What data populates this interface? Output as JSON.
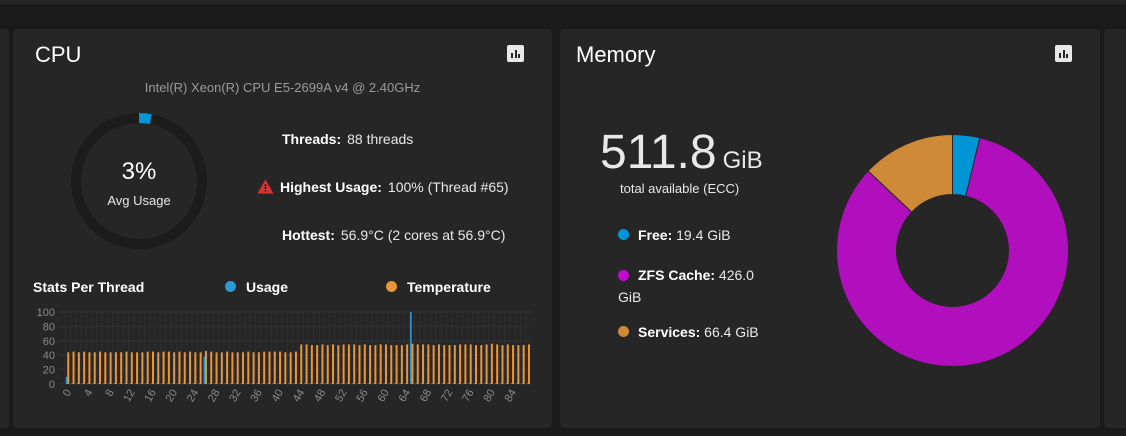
{
  "cpu": {
    "title": "CPU",
    "model": "Intel(R) Xeon(R) CPU E5-2699A v4 @ 2.40GHz",
    "avg_usage_value": "3%",
    "avg_usage_label": "Avg Usage",
    "avg_usage_fraction": 0.03,
    "threads_label": "Threads:",
    "threads_value": "88 threads",
    "highest_label": "Highest Usage:",
    "highest_value": "100%  (Thread #65)",
    "hottest_label": "Hottest:",
    "hottest_value": "56.9°C  (2 cores at 56.9°C)",
    "stats_title": "Stats Per Thread",
    "legend_usage": "Usage",
    "legend_temp": "Temperature",
    "chart_button_icon": "bar-chart-icon",
    "warning_icon": "warning-triangle-icon"
  },
  "memory": {
    "title": "Memory",
    "total_value": "511.8",
    "total_unit": "GiB",
    "total_sub": "total available (ECC)",
    "items": [
      {
        "label": "Free:",
        "value": "19.4 GiB",
        "color": "#0095d5"
      },
      {
        "label": "ZFS Cache:",
        "value": "426.0 GiB",
        "color": "#c10bd0"
      },
      {
        "label": "Services:",
        "value": "66.4 GiB",
        "color": "#ce8a37"
      }
    ],
    "chart_button_icon": "bar-chart-icon"
  },
  "colors": {
    "usage": "#2a9ad6",
    "temperature": "#e8953c",
    "free": "#0095d5",
    "zfs": "#b10fbe",
    "services": "#ce8a37"
  },
  "chart_data": [
    {
      "type": "bar",
      "title": "Stats Per Thread",
      "ylim": [
        0,
        100
      ],
      "yticks": [
        0,
        20,
        40,
        60,
        80,
        100
      ],
      "xticks": [
        0,
        4,
        8,
        12,
        16,
        20,
        24,
        28,
        32,
        36,
        40,
        44,
        48,
        52,
        56,
        60,
        64,
        68,
        72,
        76,
        80,
        84
      ],
      "categories": [
        0,
        1,
        2,
        3,
        4,
        5,
        6,
        7,
        8,
        9,
        10,
        11,
        12,
        13,
        14,
        15,
        16,
        17,
        18,
        19,
        20,
        21,
        22,
        23,
        24,
        25,
        26,
        27,
        28,
        29,
        30,
        31,
        32,
        33,
        34,
        35,
        36,
        37,
        38,
        39,
        40,
        41,
        42,
        43,
        44,
        45,
        46,
        47,
        48,
        49,
        50,
        51,
        52,
        53,
        54,
        55,
        56,
        57,
        58,
        59,
        60,
        61,
        62,
        63,
        64,
        65,
        66,
        67,
        68,
        69,
        70,
        71,
        72,
        73,
        74,
        75,
        76,
        77,
        78,
        79,
        80,
        81,
        82,
        83,
        84,
        85,
        86,
        87
      ],
      "series": [
        {
          "name": "Usage",
          "values": [
            10,
            1,
            1,
            1,
            1,
            1,
            1,
            1,
            1,
            1,
            1,
            1,
            1,
            1,
            1,
            1,
            1,
            1,
            1,
            1,
            1,
            1,
            1,
            1,
            1,
            1,
            38,
            1,
            1,
            1,
            1,
            1,
            1,
            1,
            1,
            1,
            1,
            1,
            1,
            1,
            1,
            1,
            1,
            1,
            1,
            1,
            1,
            1,
            1,
            1,
            1,
            1,
            1,
            1,
            1,
            1,
            1,
            1,
            1,
            1,
            1,
            1,
            1,
            1,
            1,
            100,
            1,
            1,
            1,
            1,
            1,
            1,
            1,
            1,
            1,
            1,
            1,
            1,
            1,
            1,
            1,
            1,
            1,
            1,
            1,
            1,
            1,
            1
          ]
        },
        {
          "name": "Temperature",
          "values": [
            44,
            45,
            44,
            45,
            44,
            44,
            45,
            44,
            44,
            44,
            44,
            45,
            44,
            44,
            44,
            45,
            45,
            44,
            45,
            45,
            44,
            45,
            44,
            45,
            44,
            44,
            46,
            45,
            44,
            44,
            45,
            44,
            44,
            44,
            45,
            44,
            44,
            45,
            45,
            45,
            45,
            44,
            44,
            45,
            55,
            55,
            54,
            54,
            55,
            54,
            55,
            54,
            55,
            55,
            55,
            54,
            55,
            54,
            54,
            55,
            55,
            54,
            54,
            54,
            55,
            56,
            55,
            55,
            55,
            54,
            55,
            54,
            54,
            54,
            55,
            55,
            55,
            54,
            54,
            55,
            56,
            55,
            54,
            55,
            54,
            54,
            54,
            55
          ]
        }
      ]
    },
    {
      "type": "pie",
      "title": "",
      "categories": [
        "Free",
        "ZFS Cache",
        "Services"
      ],
      "values": [
        19.4,
        426.0,
        66.4
      ],
      "donut": true
    }
  ]
}
